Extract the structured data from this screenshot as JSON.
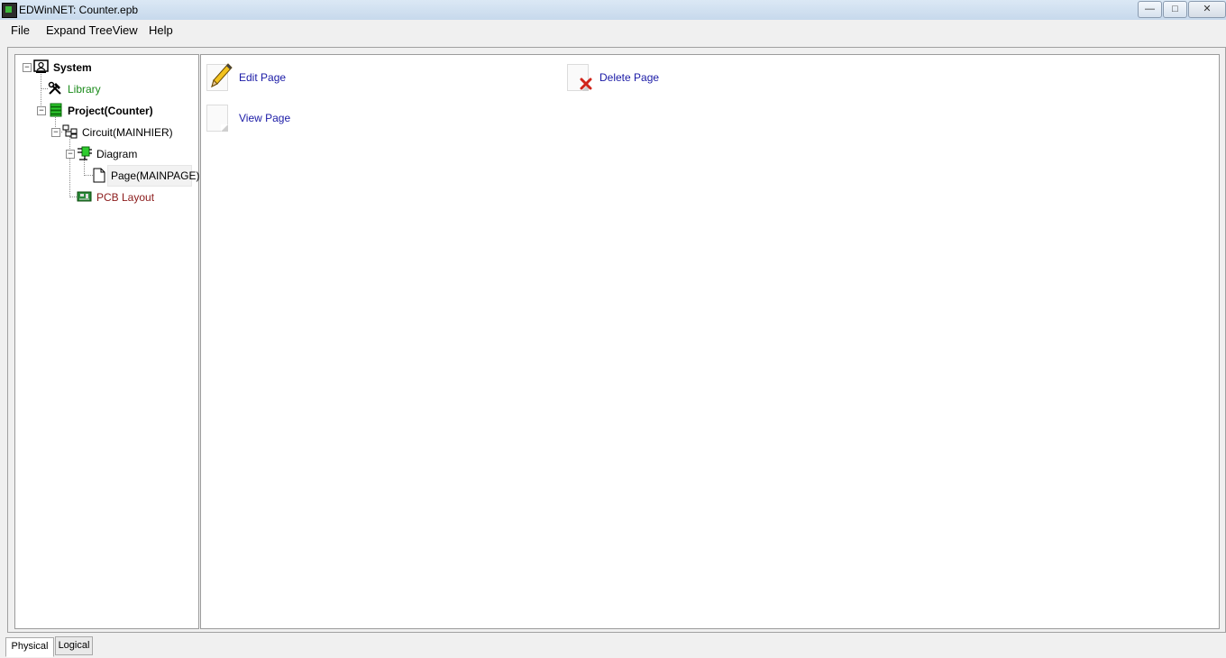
{
  "window": {
    "title": "EDWinNET: Counter.epb",
    "controls": {
      "minimize": "—",
      "maximize": "□",
      "close": "✕"
    }
  },
  "menu": {
    "items": [
      {
        "label": "File"
      },
      {
        "label": "Expand TreeView"
      },
      {
        "label": "Help"
      }
    ]
  },
  "tree": {
    "nodes": [
      {
        "label": "System",
        "icon": "system-icon",
        "bold": true,
        "color": "#000000"
      },
      {
        "label": "Library",
        "icon": "tools-icon",
        "bold": false,
        "color": "#1a8a1a"
      },
      {
        "label": "Project(Counter)",
        "icon": "project-icon",
        "bold": true,
        "color": "#000000"
      },
      {
        "label": "Circuit(MAINHIER)",
        "icon": "hierarchy-icon",
        "bold": false,
        "color": "#000000"
      },
      {
        "label": "Diagram",
        "icon": "diagram-icon",
        "bold": false,
        "color": "#000000"
      },
      {
        "label": "Page(MAINPAGE)",
        "icon": "page-icon",
        "bold": false,
        "color": "#000000",
        "selected": true
      },
      {
        "label": "PCB Layout",
        "icon": "pcb-icon",
        "bold": false,
        "color": "#8b1a1a"
      }
    ]
  },
  "actions": {
    "edit": {
      "label": "Edit Page",
      "icon": "pencil-icon"
    },
    "delete": {
      "label": "Delete Page",
      "icon": "delete-icon"
    },
    "view": {
      "label": "View Page",
      "icon": "page-icon"
    }
  },
  "tabs": [
    {
      "label": "Physical",
      "active": true
    },
    {
      "label": "Logical",
      "active": false
    }
  ],
  "colors": {
    "link": "#1a1aa6",
    "library": "#1a8a1a",
    "pcb": "#8b1a1a"
  }
}
